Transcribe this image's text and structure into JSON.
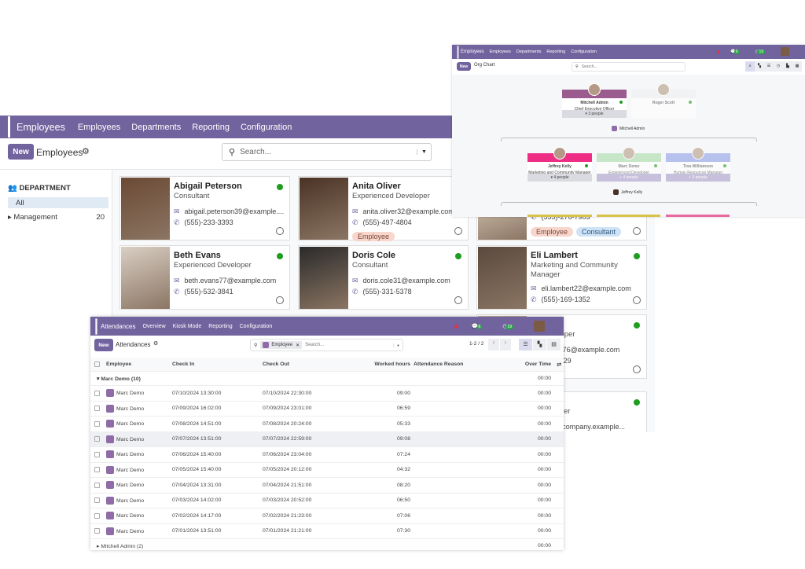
{
  "employees_app": {
    "app_name": "Employees",
    "menu": [
      "Employees",
      "Departments",
      "Reporting",
      "Configuration"
    ],
    "new_label": "New",
    "breadcrumb": "Employees",
    "search_placeholder": "Search...",
    "sidebar": {
      "heading": "DEPARTMENT",
      "items": [
        {
          "label": "All",
          "count": ""
        },
        {
          "label": "Management",
          "count": "20"
        }
      ]
    },
    "cards": [
      {
        "name": "Abigail Peterson",
        "job": "Consultant",
        "email": "abigail.peterson39@example....",
        "phone": "(555)-233-3393",
        "tags": []
      },
      {
        "name": "Anita Oliver",
        "job": "Experienced Developer",
        "email": "anita.oliver32@example.com",
        "phone": "(555)-497-4804",
        "tags": [
          "Employee"
        ]
      },
      {
        "name": "",
        "job": "",
        "email": "",
        "phone": "(555)-276-7903",
        "tags": [
          "Employee",
          "Consultant"
        ]
      },
      {
        "name": "Beth Evans",
        "job": "Experienced Developer",
        "email": "beth.evans77@example.com",
        "phone": "(555)-532-3841",
        "tags": []
      },
      {
        "name": "Doris Cole",
        "job": "Consultant",
        "email": "doris.cole31@example.com",
        "phone": "(555)-331-5378",
        "tags": []
      },
      {
        "name": "Eli Lambert",
        "job": "Marketing and Community Manager",
        "email": "eli.lambert22@example.com",
        "phone": "(555)-169-1352",
        "tags": []
      },
      {
        "name": "etcher",
        "job": "ed Developer",
        "email": "letcher76@example.com",
        "phone": "363-8229",
        "tags": []
      },
      {
        "name": "Admin",
        "job": "utive Officer",
        "email": "@yourcompany.example...",
        "phone": "",
        "tags": []
      }
    ]
  },
  "org_chart_app": {
    "app_name": "Employees",
    "menu": [
      "Employees",
      "Departments",
      "Reporting",
      "Configuration"
    ],
    "new_label": "New",
    "breadcrumb": "Org Chart",
    "search_placeholder": "Search...",
    "badges": {
      "messages": "6",
      "activities": "19"
    },
    "nodes": [
      {
        "name": "Mitchell Admin",
        "job": "Chief Executive Officer",
        "people": "▾ 3 people",
        "color": "#9b5b8e"
      },
      {
        "name": "Roger Scott",
        "job": "",
        "people": "",
        "color": "#eeeff2"
      },
      {
        "name": "Jeffrey Kelly",
        "job": "Marketing and Community Manager",
        "people": "▾ 4 people",
        "color": "#ee2d84"
      },
      {
        "name": "Marc Demo",
        "job": "Experienced Developer",
        "people": "+ 4 people",
        "color": "#a8dca8"
      },
      {
        "name": "Tina Williamson",
        "job": "Human Resources Manager",
        "people": "+ 3 people",
        "color": "#8e9ee8"
      }
    ],
    "level_labels": [
      "Mitchell Admin",
      "Jeffrey Kelly"
    ]
  },
  "attendance_app": {
    "app_name": "Attendances",
    "menu": [
      "Overview",
      "Kiosk Mode",
      "Reporting",
      "Configuration"
    ],
    "new_label": "New",
    "breadcrumb": "Attendances",
    "filter_facet": "Employee",
    "search_placeholder": "Search...",
    "pager": "1-2 / 2",
    "badges": {
      "messages": "6",
      "activities": "19"
    },
    "columns": [
      "Employee",
      "Check In",
      "Check Out",
      "Worked hours",
      "Attendance Reason",
      "Over Time"
    ],
    "groups": [
      {
        "label": "Marc Demo (10)",
        "overtime": "00:00",
        "expanded": true
      },
      {
        "label": "Mitchell Admin (2)",
        "overtime": "00:00",
        "expanded": false
      }
    ],
    "rows": [
      {
        "employee": "Marc Demo",
        "check_in": "07/10/2024 13:30:00",
        "check_out": "07/10/2024 22:30:00",
        "worked": "09:00",
        "overtime": "00:00"
      },
      {
        "employee": "Marc Demo",
        "check_in": "07/09/2024 16:02:00",
        "check_out": "07/09/2024 23:01:00",
        "worked": "06:59",
        "overtime": "00:00"
      },
      {
        "employee": "Marc Demo",
        "check_in": "07/08/2024 14:51:00",
        "check_out": "07/08/2024 20:24:00",
        "worked": "05:33",
        "overtime": "00:00"
      },
      {
        "employee": "Marc Demo",
        "check_in": "07/07/2024 13:51:00",
        "check_out": "07/07/2024 22:59:00",
        "worked": "09:08",
        "overtime": "00:00"
      },
      {
        "employee": "Marc Demo",
        "check_in": "07/06/2024 15:40:00",
        "check_out": "07/06/2024 23:04:00",
        "worked": "07:24",
        "overtime": "00:00"
      },
      {
        "employee": "Marc Demo",
        "check_in": "07/05/2024 15:40:00",
        "check_out": "07/05/2024 20:12:00",
        "worked": "04:32",
        "overtime": "00:00"
      },
      {
        "employee": "Marc Demo",
        "check_in": "07/04/2024 13:31:00",
        "check_out": "07/04/2024 21:51:00",
        "worked": "08:20",
        "overtime": "00:00"
      },
      {
        "employee": "Marc Demo",
        "check_in": "07/03/2024 14:02:00",
        "check_out": "07/03/2024 20:52:00",
        "worked": "06:50",
        "overtime": "00:00"
      },
      {
        "employee": "Marc Demo",
        "check_in": "07/02/2024 14:17:00",
        "check_out": "07/02/2024 21:23:00",
        "worked": "07:06",
        "overtime": "00:00"
      },
      {
        "employee": "Marc Demo",
        "check_in": "07/01/2024 13:51:00",
        "check_out": "07/01/2024 21:21:00",
        "worked": "07:30",
        "overtime": "00:00"
      }
    ]
  }
}
